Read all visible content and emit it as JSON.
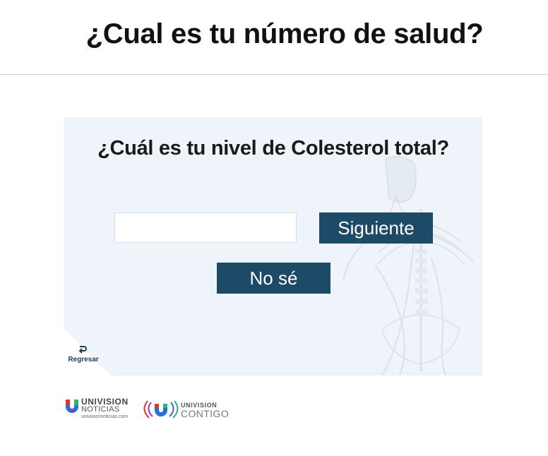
{
  "header": {
    "title": "¿Cual es tu número de salud?"
  },
  "quiz": {
    "question": "¿Cuál es tu nivel de Colesterol total?",
    "answer_value": "",
    "answer_placeholder": "",
    "next_label": "Siguiente",
    "unknown_label": "No sé",
    "back_label": "Regresar"
  },
  "logos": {
    "univision_noticias": {
      "brand": "UNIVISION",
      "sub": "NOTICIAS",
      "site": "univisionnoticias.com"
    },
    "univision_contigo": {
      "brand": "UNIVISION",
      "sub": "CONTIGO"
    }
  },
  "colors": {
    "button": "#1d4a66",
    "card_bg": "#eef4f9",
    "title": "#111111"
  }
}
